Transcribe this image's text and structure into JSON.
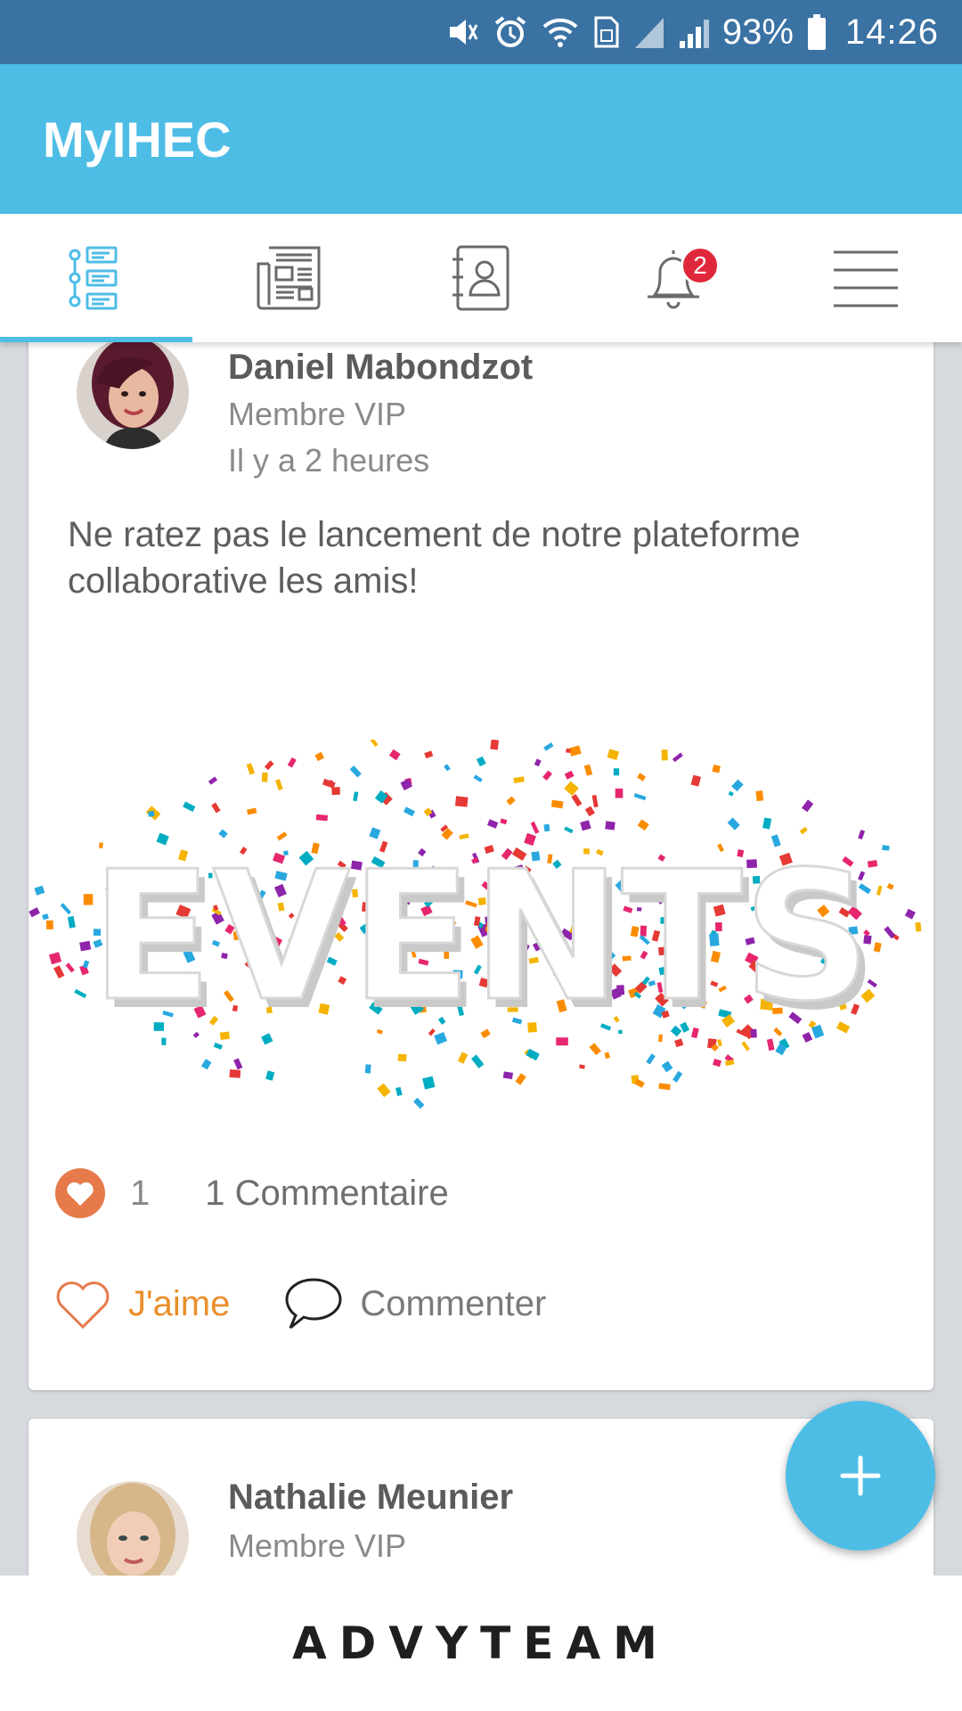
{
  "status_bar": {
    "battery_percent": "93%",
    "time": "14:26",
    "icons": [
      "mute-icon",
      "alarm-icon",
      "wifi-icon",
      "sim-icon",
      "signal-icon",
      "signal-icon",
      "battery-icon"
    ]
  },
  "app_bar": {
    "title": "MyIHEC"
  },
  "tabs": [
    {
      "name": "feed",
      "icon": "timeline-icon",
      "active": true
    },
    {
      "name": "news",
      "icon": "newspaper-icon",
      "active": false
    },
    {
      "name": "contacts",
      "icon": "contacts-book-icon",
      "active": false
    },
    {
      "name": "notifications",
      "icon": "bell-icon",
      "active": false,
      "badge": "2"
    },
    {
      "name": "menu",
      "icon": "hamburger-menu-icon",
      "active": false
    }
  ],
  "posts": [
    {
      "author": "Daniel Mabondzot",
      "role": "Membre VIP",
      "time_ago": "Il y a 2 heures",
      "text": "Ne ratez pas le lancement de notre plateforme collaborative les amis!",
      "image_text": "EVENTS",
      "likes": "1",
      "comments": "1 Commentaire",
      "like_label": "J'aime",
      "comment_label": "Commenter"
    },
    {
      "author": "Nathalie Meunier",
      "role": "Membre VIP"
    }
  ],
  "footer": {
    "logo_text": "ADVYTEAM"
  },
  "colors": {
    "status_bar": "#3a72a3",
    "app_bar": "#4dbde6",
    "accent": "#4dbde6",
    "like_orange": "#e98f2c",
    "heart_fill": "#e67a4a",
    "badge_red": "#e0283c"
  }
}
